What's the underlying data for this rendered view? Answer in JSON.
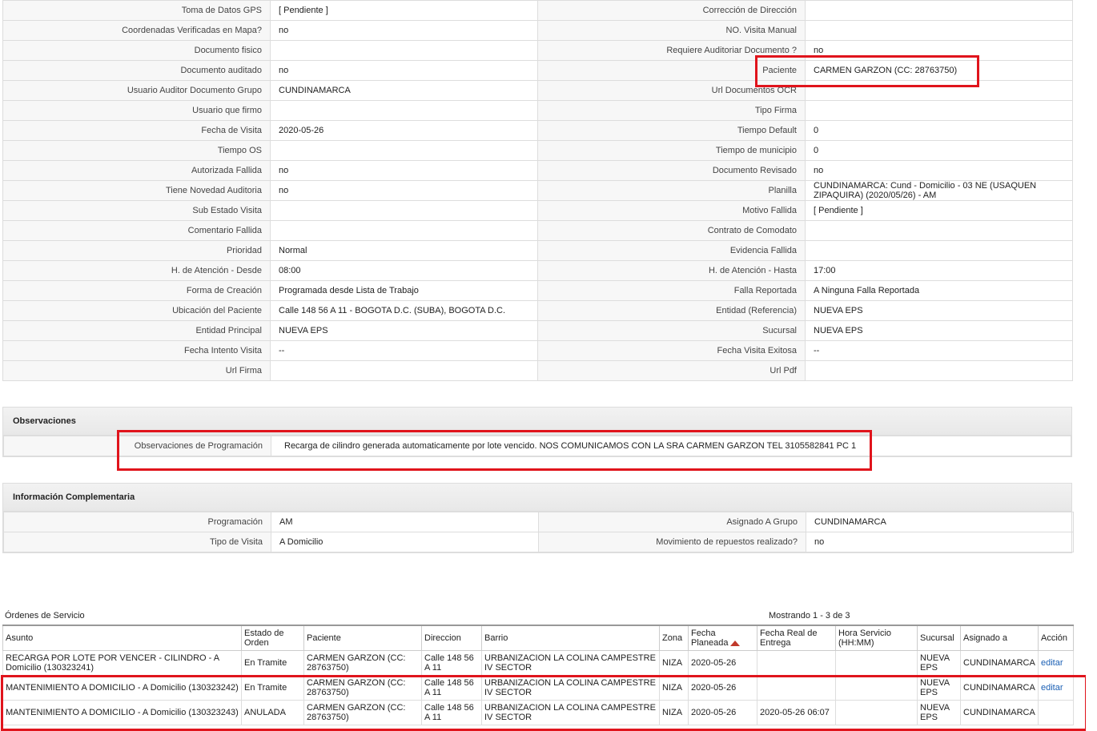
{
  "details": [
    {
      "l1": "Toma de Datos GPS",
      "v1": "[ Pendiente ]",
      "l2": "Corrección de Dirección",
      "v2": ""
    },
    {
      "l1": "Coordenadas Verificadas en Mapa?",
      "v1": "no",
      "l2": "NO. Visita Manual",
      "v2": ""
    },
    {
      "l1": "Documento fisico",
      "v1": "",
      "l2": "Requiere Auditoriar Documento ?",
      "v2": "no"
    },
    {
      "l1": "Documento auditado",
      "v1": "no",
      "l2": "Paciente",
      "v2": "CARMEN GARZON (CC: 28763750)"
    },
    {
      "l1": "Usuario Auditor Documento Grupo",
      "v1": "CUNDINAMARCA",
      "l2": "Url Documentos OCR",
      "v2": ""
    },
    {
      "l1": "Usuario que firmo",
      "v1": "",
      "l2": "Tipo Firma",
      "v2": ""
    },
    {
      "l1": "Fecha de Visita",
      "v1": "2020-05-26",
      "l2": "Tiempo Default",
      "v2": "0"
    },
    {
      "l1": "Tiempo OS",
      "v1": "",
      "l2": "Tiempo de municipio",
      "v2": "0"
    },
    {
      "l1": "Autorizada Fallida",
      "v1": "no",
      "l2": "Documento Revisado",
      "v2": "no"
    },
    {
      "l1": "Tiene Novedad Auditoria",
      "v1": "no",
      "l2": "Planilla",
      "v2": "CUNDINAMARCA: Cund - Domicilio - 03 NE (USAQUEN ZIPAQUIRA) (2020/05/26) - AM"
    },
    {
      "l1": "Sub Estado Visita",
      "v1": "",
      "l2": "Motivo Fallida",
      "v2": "[ Pendiente ]"
    },
    {
      "l1": "Comentario Fallida",
      "v1": "",
      "l2": "Contrato de Comodato",
      "v2": ""
    },
    {
      "l1": "Prioridad",
      "v1": "Normal",
      "l2": "Evidencia Fallida",
      "v2": ""
    },
    {
      "l1": "H. de Atención - Desde",
      "v1": "08:00",
      "l2": "H. de Atención - Hasta",
      "v2": "17:00"
    },
    {
      "l1": "Forma de Creación",
      "v1": "Programada desde Lista de Trabajo",
      "l2": "Falla Reportada",
      "v2": "A Ninguna Falla Reportada"
    },
    {
      "l1": "Ubicación del Paciente",
      "v1": "Calle 148 56 A 11 - BOGOTA D.C. (SUBA), BOGOTA D.C.",
      "l2": "Entidad (Referencia)",
      "v2": "NUEVA EPS"
    },
    {
      "l1": "Entidad Principal",
      "v1": "NUEVA EPS",
      "l2": "Sucursal",
      "v2": "NUEVA EPS"
    },
    {
      "l1": "Fecha Intento Visita",
      "v1": "--",
      "l2": "Fecha Visita Exitosa",
      "v2": "--"
    },
    {
      "l1": "Url Firma",
      "v1": "",
      "l2": "Url Pdf",
      "v2": ""
    }
  ],
  "observaciones": {
    "title": "Observaciones",
    "label": "Observaciones de Programación",
    "value": "Recarga de cilindro generada automaticamente por lote vencido. NOS COMUNICAMOS CON LA SRA CARMEN GARZON TEL 3105582841 PC 1"
  },
  "complementaria": {
    "title": "Información Complementaria",
    "rows": [
      {
        "l1": "Programación",
        "v1": "AM",
        "l2": "Asignado A Grupo",
        "v2": "CUNDINAMARCA"
      },
      {
        "l1": "Tipo de Visita",
        "v1": "A Domicilio",
        "l2": "Movimiento de repuestos realizado?",
        "v2": "no"
      }
    ]
  },
  "orders": {
    "title": "Órdenes de Servicio",
    "count_text": "Mostrando 1 - 3 de 3",
    "headers": {
      "asunto": "Asunto",
      "estado": "Estado de Orden",
      "paciente": "Paciente",
      "direccion": "Direccion",
      "barrio": "Barrio",
      "zona": "Zona",
      "fecha_planeada": "Fecha Planeada",
      "fecha_real": "Fecha Real de Entrega",
      "hora": "Hora Servicio (HH:MM)",
      "sucursal": "Sucursal",
      "asignado": "Asignado a",
      "accion": "Acción"
    },
    "rows": [
      {
        "asunto": "RECARGA POR LOTE POR VENCER - CILINDRO - A Domicilio (130323241)",
        "estado": "En Tramite",
        "paciente": "CARMEN GARZON (CC: 28763750)",
        "direccion": "Calle 148 56 A 11",
        "barrio": "URBANIZACION LA COLINA CAMPESTRE IV SECTOR",
        "zona": "NIZA",
        "fecha_planeada": "2020-05-26",
        "fecha_real": "",
        "hora": "",
        "sucursal": "NUEVA EPS",
        "asignado": "CUNDINAMARCA",
        "accion": "editar"
      },
      {
        "asunto": "MANTENIMIENTO A DOMICILIO - A Domicilio (130323242)",
        "estado": "En Tramite",
        "paciente": "CARMEN GARZON (CC: 28763750)",
        "direccion": "Calle 148 56 A 11",
        "barrio": "URBANIZACION LA COLINA CAMPESTRE IV SECTOR",
        "zona": "NIZA",
        "fecha_planeada": "2020-05-26",
        "fecha_real": "",
        "hora": "",
        "sucursal": "NUEVA EPS",
        "asignado": "CUNDINAMARCA",
        "accion": "editar"
      },
      {
        "asunto": "MANTENIMIENTO A DOMICILIO - A Domicilio (130323243)",
        "estado": "ANULADA",
        "paciente": "CARMEN GARZON (CC: 28763750)",
        "direccion": "Calle 148 56 A 11",
        "barrio": "URBANIZACION LA COLINA CAMPESTRE IV SECTOR",
        "zona": "NIZA",
        "fecha_planeada": "2020-05-26",
        "fecha_real": "2020-05-26 06:07",
        "hora": "",
        "sucursal": "NUEVA EPS",
        "asignado": "CUNDINAMARCA",
        "accion": ""
      }
    ]
  },
  "colors": {
    "highlight": "#e0141c",
    "label_bg": "#f7f7f7",
    "sort_arrow": "#c0392b",
    "link": "#1a5fb4"
  }
}
